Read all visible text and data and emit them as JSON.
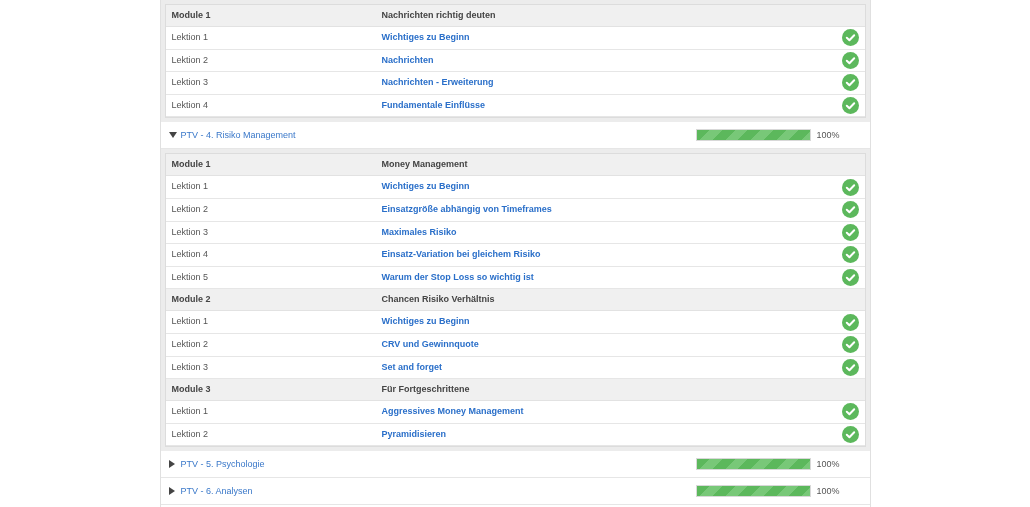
{
  "top_modules": [
    {
      "label": "Module 1",
      "title": "Nachrichten richtig deuten",
      "lessons": [
        {
          "label": "Lektion 1",
          "title": "Wichtiges zu Beginn",
          "done": true
        },
        {
          "label": "Lektion 2",
          "title": "Nachrichten",
          "done": true
        },
        {
          "label": "Lektion 3",
          "title": "Nachrichten - Erweiterung",
          "done": true
        },
        {
          "label": "Lektion 4",
          "title": "Fundamentale Einflüsse",
          "done": true
        }
      ]
    }
  ],
  "courses": [
    {
      "title": "PTV - 4. Risiko Management",
      "expanded": true,
      "level": 1,
      "reading": "100%",
      "modules": [
        {
          "label": "Module 1",
          "title": "Money Management",
          "lessons": [
            {
              "label": "Lektion 1",
              "title": "Wichtiges zu Beginn",
              "done": true
            },
            {
              "label": "Lektion 2",
              "title": "Einsatzgröße abhängig von Timeframes",
              "done": true
            },
            {
              "label": "Lektion 3",
              "title": "Maximales Risiko",
              "done": true
            },
            {
              "label": "Lektion 4",
              "title": "Einsatz-Variation bei gleichem Risiko",
              "done": true
            },
            {
              "label": "Lektion 5",
              "title": "Warum der Stop Loss so wichtig ist",
              "done": true
            }
          ]
        },
        {
          "label": "Module 2",
          "title": "Chancen Risiko Verhältnis",
          "lessons": [
            {
              "label": "Lektion 1",
              "title": "Wichtiges zu Beginn",
              "done": true
            },
            {
              "label": "Lektion 2",
              "title": "CRV und Gewinnquote",
              "done": true
            },
            {
              "label": "Lektion 3",
              "title": "Set and forget",
              "done": true
            }
          ]
        },
        {
          "label": "Module 3",
          "title": "Für Fortgeschrittene",
          "lessons": [
            {
              "label": "Lektion 1",
              "title": "Aggressives Money Management",
              "done": true
            },
            {
              "label": "Lektion 2",
              "title": "Pyramidisieren",
              "done": true
            }
          ]
        }
      ]
    },
    {
      "title": "PTV - 5. Psychologie",
      "expanded": false,
      "level": 1,
      "reading": "100%"
    },
    {
      "title": "PTV - 6. Analysen",
      "expanded": false,
      "level": 1,
      "reading": "100%"
    }
  ]
}
